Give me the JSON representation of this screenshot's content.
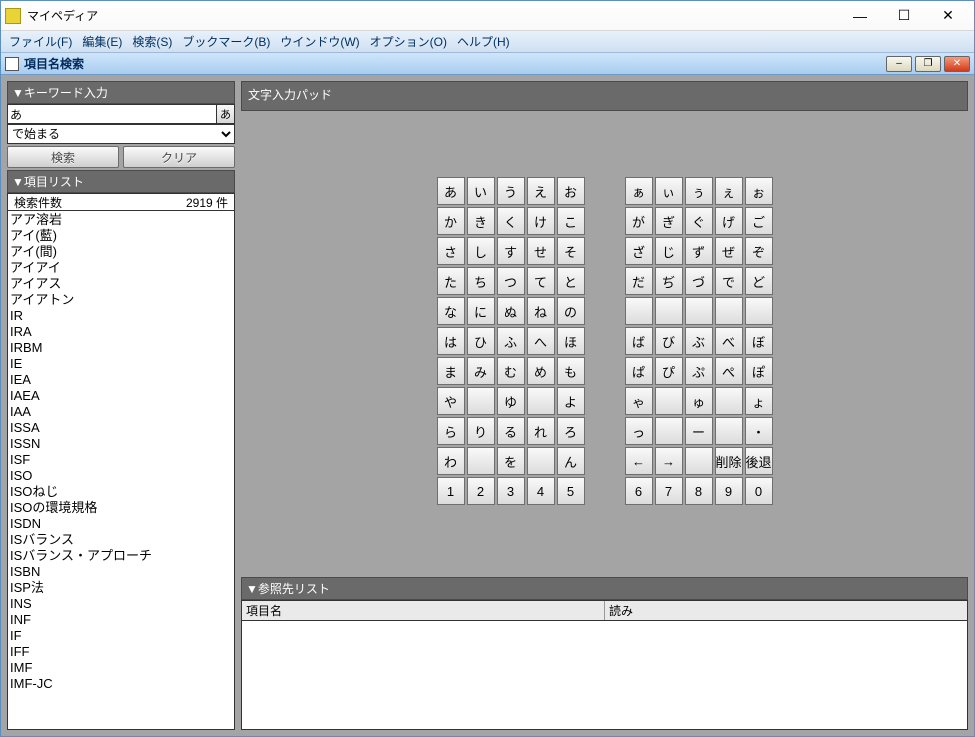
{
  "app": {
    "title": "マイペディア"
  },
  "menu": {
    "file": "ファイル(F)",
    "edit": "編集(E)",
    "search": "検索(S)",
    "bookmark": "ブックマーク(B)",
    "window": "ウインドウ(W)",
    "option": "オプション(O)",
    "help": "ヘルプ(H)"
  },
  "inner": {
    "title": "項目名検索"
  },
  "left": {
    "kw_header": "▼キーワード入力",
    "kw_value": "あ",
    "kw_ime": "あ",
    "mode_value": "で始まる",
    "search_btn": "検索",
    "clear_btn": "クリア",
    "list_header": "▼項目リスト",
    "count_label": "検索件数",
    "count_value": "2919 件",
    "results": [
      "アア溶岩",
      "アイ(藍)",
      "アイ(間)",
      "アイアイ",
      "アイアス",
      "アイアトン",
      "IR",
      "IRA",
      "IRBM",
      "IE",
      "IEA",
      "IAEA",
      "IAA",
      "ISSA",
      "ISSN",
      "ISF",
      "ISO",
      "ISOねじ",
      "ISOの環境規格",
      "ISDN",
      "ISバランス",
      "ISバランス・アプローチ",
      "ISBN",
      "ISP法",
      "INS",
      "INF",
      "IF",
      "IFF",
      "IMF",
      "IMF-JC"
    ]
  },
  "right": {
    "pad_title": "文字入力パッド",
    "ref_header": "▼参照先リスト",
    "ref_col1": "項目名",
    "ref_col2": "読み"
  },
  "kana": {
    "base": [
      [
        "あ",
        "い",
        "う",
        "え",
        "お"
      ],
      [
        "か",
        "き",
        "く",
        "け",
        "こ"
      ],
      [
        "さ",
        "し",
        "す",
        "せ",
        "そ"
      ],
      [
        "た",
        "ち",
        "つ",
        "て",
        "と"
      ],
      [
        "な",
        "に",
        "ぬ",
        "ね",
        "の"
      ],
      [
        "は",
        "ひ",
        "ふ",
        "へ",
        "ほ"
      ],
      [
        "ま",
        "み",
        "む",
        "め",
        "も"
      ],
      [
        "や",
        "",
        "ゆ",
        "",
        "よ"
      ],
      [
        "ら",
        "り",
        "る",
        "れ",
        "ろ"
      ],
      [
        "わ",
        "",
        "を",
        "",
        "ん"
      ],
      [
        "1",
        "2",
        "3",
        "4",
        "5"
      ]
    ],
    "alt": [
      [
        "ぁ",
        "ぃ",
        "ぅ",
        "ぇ",
        "ぉ"
      ],
      [
        "が",
        "ぎ",
        "ぐ",
        "げ",
        "ご"
      ],
      [
        "ざ",
        "じ",
        "ず",
        "ぜ",
        "ぞ"
      ],
      [
        "だ",
        "ぢ",
        "づ",
        "で",
        "ど"
      ],
      [
        "",
        "",
        "",
        "",
        ""
      ],
      [
        "ば",
        "び",
        "ぶ",
        "べ",
        "ぼ"
      ],
      [
        "ぱ",
        "ぴ",
        "ぷ",
        "ぺ",
        "ぽ"
      ],
      [
        "ゃ",
        "",
        "ゅ",
        "",
        "ょ"
      ],
      [
        "っ",
        "",
        "ー",
        "",
        "・"
      ],
      [
        "←",
        "→",
        "",
        "削除",
        "後退"
      ],
      [
        "6",
        "7",
        "8",
        "9",
        "0"
      ]
    ]
  }
}
